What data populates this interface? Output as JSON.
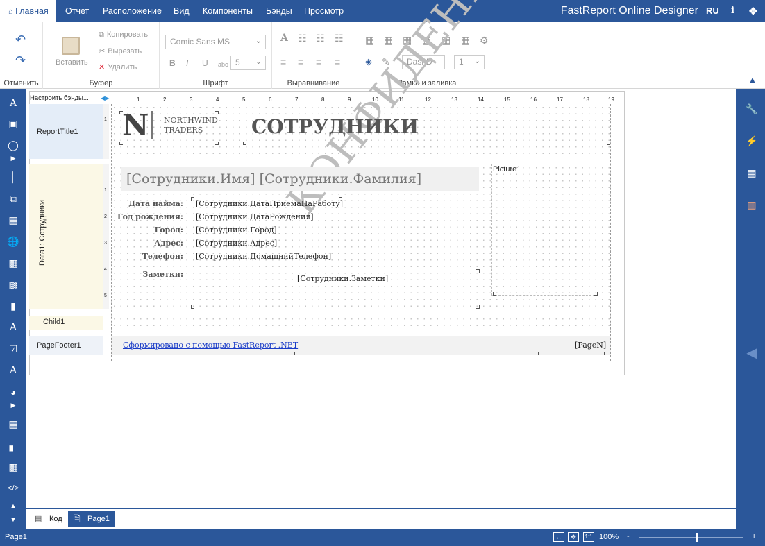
{
  "topbar": {
    "tabs": [
      "Главная",
      "Отчет",
      "Расположение",
      "Вид",
      "Компоненты",
      "Бэнды",
      "Просмотр"
    ],
    "home_icon": "home-icon",
    "brand": "FastReport Online Designer",
    "lang": "RU",
    "info_icon": "info-icon",
    "fullscreen_icon": "fullscreen-icon"
  },
  "ribbon": {
    "undo_group": "Отменить",
    "clipboard_group": "Буфер",
    "paste_label": "Вставить",
    "copy_label": "Копировать",
    "cut_label": "Вырезать",
    "delete_label": "Удалить",
    "font_group": "Шрифт",
    "font_name": "Comic Sans MS",
    "font_size": "5",
    "bold": "B",
    "italic": "I",
    "underline": "U",
    "strike": "abc",
    "align_group": "Выравнивание",
    "border_group": "Рамка и заливка",
    "dash_style": "DashD",
    "border_width": "1"
  },
  "bands": {
    "configure": "Настроить бэнды...",
    "report_title": "ReportTitle1",
    "data": "Data1: Сотрудники",
    "child": "Child1",
    "page_footer": "PageFooter1"
  },
  "ruler": {
    "top": [
      "1",
      "2",
      "3",
      "4",
      "5",
      "6",
      "7",
      "8",
      "9",
      "10",
      "11",
      "12",
      "13",
      "14",
      "15",
      "16",
      "17",
      "18",
      "19"
    ],
    "left_title": [
      "1"
    ],
    "left_data": [
      "1",
      "2",
      "3",
      "4",
      "5"
    ]
  },
  "report": {
    "logo_letter": "N",
    "logo_line1": "NORTHWIND",
    "logo_line2": "TRADERS",
    "title": "СОТРУДНИКИ",
    "name_field": "[Сотрудники.Имя] [Сотрудники.Фамилия]",
    "picture": "Picture1",
    "labels": [
      "Дата найма:",
      "Год рождения:",
      "Город:",
      "Адрес:",
      "Телефон:",
      "Заметки:"
    ],
    "values": [
      "[Сотрудники.ДатаПриемаНаРаботу]",
      "[Сотрудники.ДатаРождения]",
      "[Сотрудники.Город]",
      "[Сотрудники.Адрес]",
      "[Сотрудники.ДомашнийТелефон]"
    ],
    "notes": "[Сотрудники.Заметки]",
    "watermark": "КОНФИДЕНЦ",
    "footer_link": "Сформировано с помощью FastReport .NET",
    "page_number": "[PageN]"
  },
  "bottom_tabs": {
    "code": "Код",
    "page": "Page1"
  },
  "status": {
    "page": "Page1",
    "zoom": "100%",
    "minus": "-",
    "plus": "+",
    "zoom_level": 0.55
  },
  "colors": {
    "accent": "#2b579a",
    "title_band": "#e4edf8",
    "data_band": "#fbf8e6",
    "footer_band": "#eef2f8"
  }
}
